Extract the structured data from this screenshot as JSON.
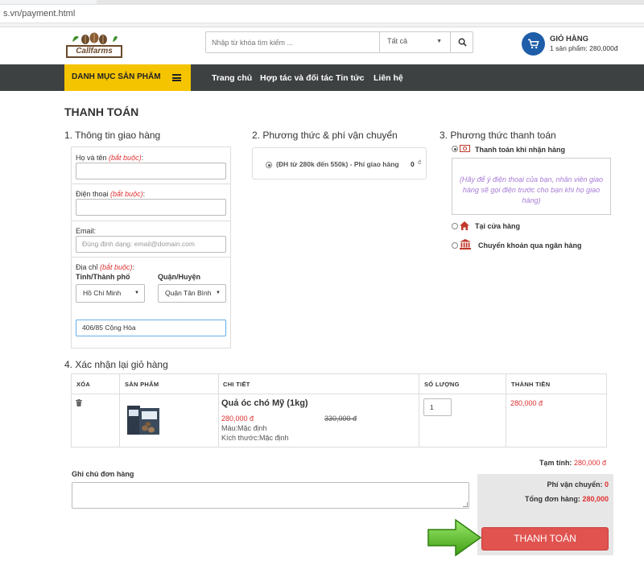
{
  "browser": {
    "url": "s.vn/payment.html"
  },
  "header": {
    "logo_text": "Callfarms",
    "search_placeholder": "Nhập từ khóa tìm kiếm ...",
    "search_category": "Tất cả",
    "cart_title": "GIỎ HÀNG",
    "cart_summary": "1 sản phẩm: 280,000đ"
  },
  "nav": {
    "category_label": "DANH MỤC SẢN PHẨM",
    "items": [
      "Trang chủ",
      "Hợp tác và đối tác",
      "Tin tức",
      "Liên hệ"
    ]
  },
  "page_title": "THANH TOÁN",
  "shipping_info": {
    "title": "1. Thông tin giao hàng",
    "required_text": "(bắt buộc)",
    "name_label": "Họ và tên",
    "phone_label": "Điện thoại",
    "email_label": "Email:",
    "email_placeholder": "Đúng định dạng: email@domain.com",
    "address_label": "Địa chỉ",
    "province_label": "Tỉnh/Thành phố",
    "province_value": "Hồ Chí Minh",
    "district_label": "Quận/Huyện",
    "district_value": "Quận Tân Bình",
    "address_value": "406/85 Cộng Hòa"
  },
  "shipping_method": {
    "title": "2. Phương thức & phí vận chuyển",
    "option_label": "(ĐH từ 280k đến 550k) - Phí giao hàng",
    "option_fee": "0",
    "option_currency": "đ"
  },
  "payment_method": {
    "title": "3. Phương thức thanh toán",
    "options": [
      "Thanh toán khi nhận hàng",
      "Tại cửa hàng",
      "Chuyển khoản qua ngân hàng"
    ],
    "cod_note": "(Hãy để ý điện thoại của bạn, nhân viên giao hàng sẽ gọi điện trước cho bạn khi họ giao hàng)"
  },
  "cart": {
    "title": "4. Xác nhận lại giỏ hàng",
    "columns": [
      "XÓA",
      "SẢN PHẨM",
      "CHI TIẾT",
      "SỐ LƯỢNG",
      "THÀNH TIỀN"
    ],
    "item": {
      "name": "Quả óc chó Mỹ (1kg)",
      "price": "280,000 đ",
      "old_price": "330,000 đ",
      "color": "Màu:Mặc định",
      "size": "Kích thước:Mặc định",
      "quantity": "1",
      "total": "280,000 đ"
    }
  },
  "order_note_label": "Ghi chú đơn hàng",
  "summary": {
    "subtotal_label": "Tạm tính:",
    "subtotal_value": "280,000 đ",
    "shipping_label": "Phí vận chuyển:",
    "shipping_value": "0",
    "total_label": "Tổng đơn hàng:",
    "total_value": "280,000"
  },
  "pay_button_label": "THANH TOÁN",
  "colors": {
    "nav_bg": "#3e4142",
    "category_bg": "#f5c400",
    "accent_red": "#e03030",
    "button_red": "#e0534f",
    "cart_blue": "#1e5ea8",
    "arrow_green": "#4caf1a"
  }
}
